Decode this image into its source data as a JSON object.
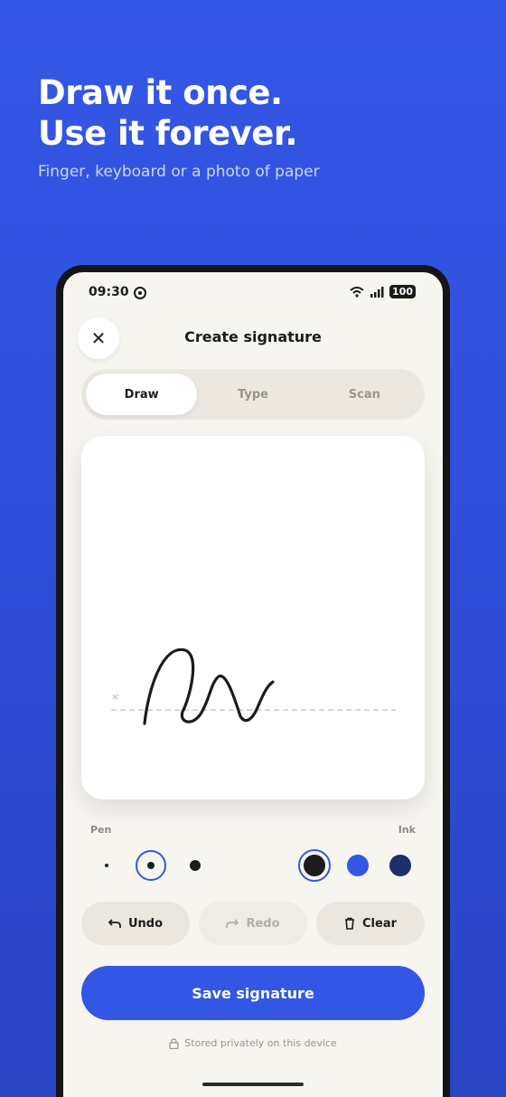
{
  "promo": {
    "headline_line1": "Draw it once.",
    "headline_line2": "Use it forever.",
    "subline": "Finger, keyboard or a photo of paper"
  },
  "status_bar": {
    "time": "09:30",
    "battery": "100"
  },
  "header": {
    "title": "Create signature",
    "close_icon": "close-icon"
  },
  "tabs": [
    {
      "label": "Draw",
      "active": true
    },
    {
      "label": "Type",
      "active": false
    },
    {
      "label": "Scan",
      "active": false
    }
  ],
  "canvas": {
    "baseline_marker": "×"
  },
  "pen": {
    "label": "Pen",
    "sizes": [
      "small",
      "medium",
      "large"
    ],
    "selected": "medium"
  },
  "ink": {
    "label": "Ink",
    "colors": [
      "#1c1c1c",
      "#3356e4",
      "#1f2f6b"
    ],
    "selected": "#1c1c1c"
  },
  "actions": {
    "undo": "Undo",
    "redo": "Redo",
    "clear": "Clear"
  },
  "save_label": "Save signature",
  "privacy_note": "Stored privately on this device",
  "colors": {
    "accent": "#3356e4",
    "background": "#f7f5f0"
  }
}
